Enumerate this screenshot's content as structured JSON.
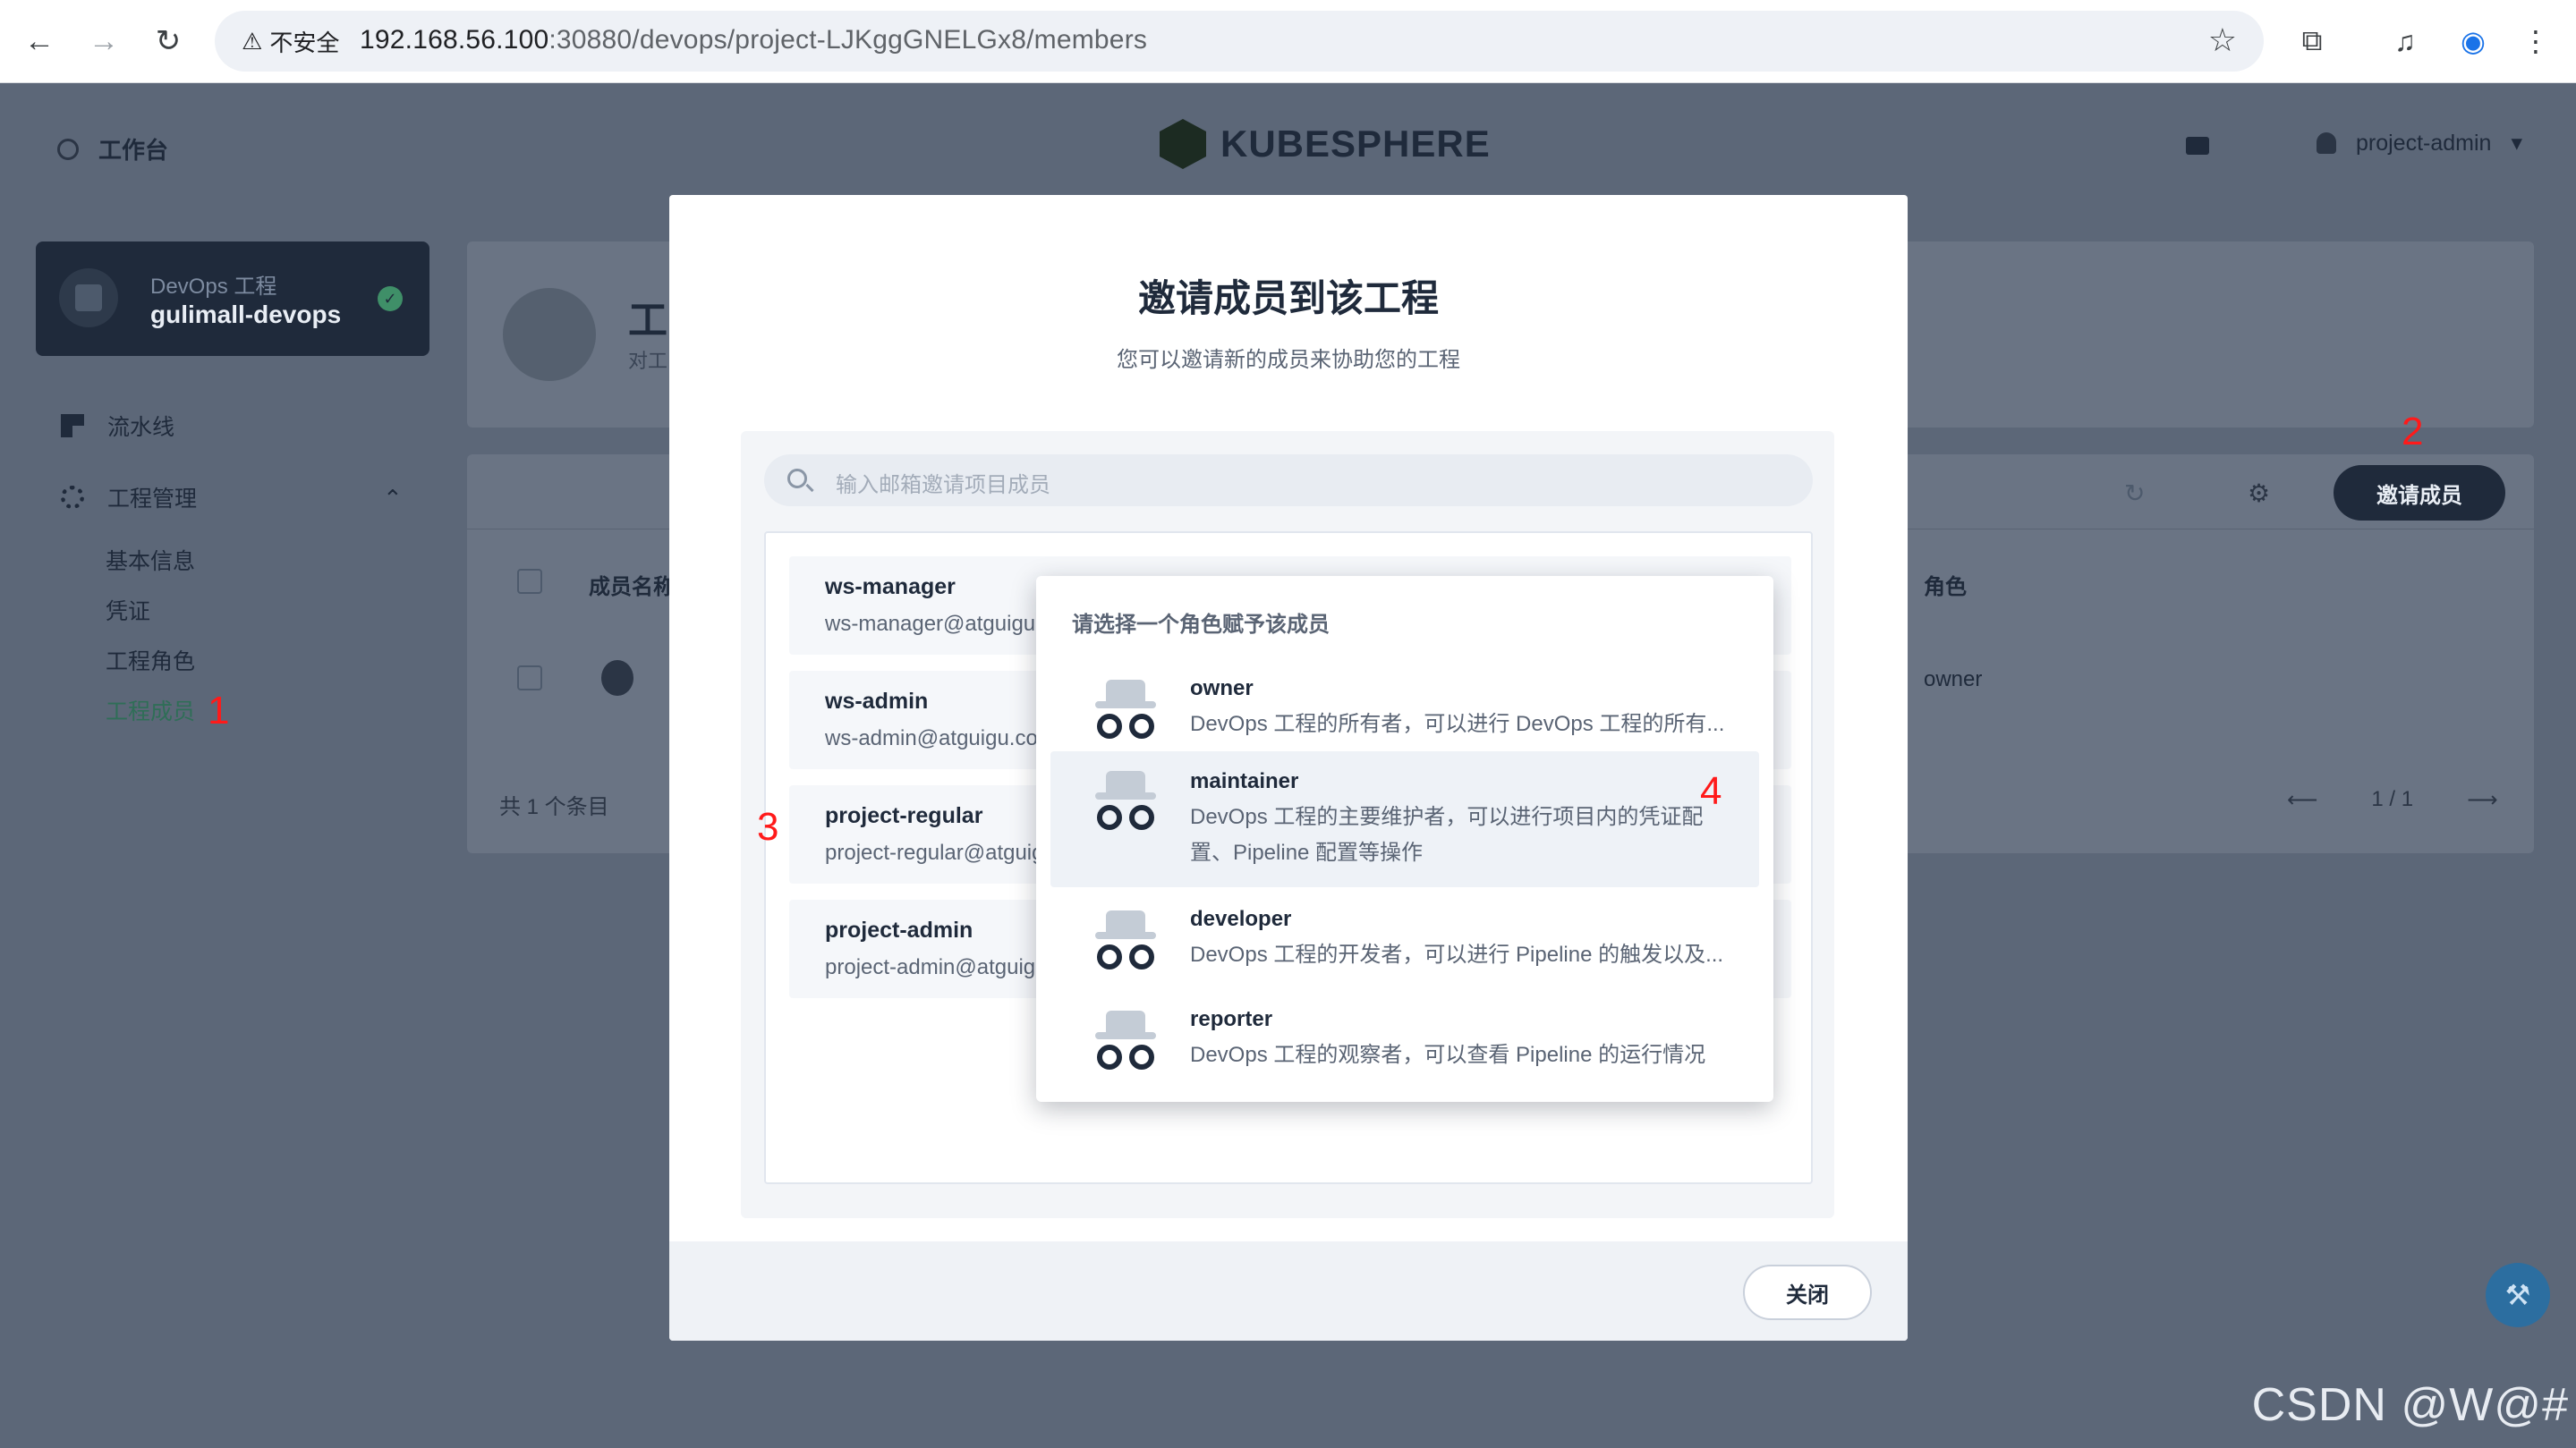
{
  "browser": {
    "security_label": "不安全",
    "url_host": "192.168.56.100",
    "url_rest": ":30880/devops/project-LJKggGNELGx8/members"
  },
  "header": {
    "workbench_label": "工作台",
    "logo_text": "KUBESPHERE",
    "username": "project-admin"
  },
  "sidebar": {
    "project_type": "DevOps 工程",
    "project_name": "gulimall-devops",
    "items": [
      {
        "label": "流水线"
      },
      {
        "label": "工程管理"
      }
    ],
    "sub_items": [
      {
        "label": "基本信息"
      },
      {
        "label": "凭证"
      },
      {
        "label": "工程角色"
      },
      {
        "label": "工程成员",
        "active": true
      }
    ]
  },
  "background": {
    "title_partial": "工",
    "subtitle_partial": "对工",
    "invite_button": "邀请成员",
    "col_name": "成员名称",
    "col_role": "角色",
    "row_role": "owner",
    "footer_count": "共 1 个条目",
    "page_info": "1 / 1"
  },
  "annotations": [
    "1",
    "2",
    "3",
    "4"
  ],
  "modal": {
    "title": "邀请成员到该工程",
    "subtitle": "您可以邀请新的成员来协助您的工程",
    "search_placeholder": "输入邮箱邀请项目成员",
    "users": [
      {
        "name": "ws-manager",
        "email": "ws-manager@atguigu."
      },
      {
        "name": "ws-admin",
        "email": "ws-admin@atguigu.co"
      },
      {
        "name": "project-regular",
        "email": "project-regular@atguig"
      },
      {
        "name": "project-admin",
        "email": "project-admin@atguigu"
      }
    ],
    "close_button": "关闭"
  },
  "role_dropdown": {
    "title": "请选择一个角色赋予该成员",
    "roles": [
      {
        "name": "owner",
        "desc": "DevOps 工程的所有者，可以进行 DevOps 工程的所有..."
      },
      {
        "name": "maintainer",
        "desc": "DevOps 工程的主要维护者，可以进行项目内的凭证配置、Pipeline 配置等操作",
        "selected": true
      },
      {
        "name": "developer",
        "desc": "DevOps 工程的开发者，可以进行 Pipeline 的触发以及..."
      },
      {
        "name": "reporter",
        "desc": "DevOps 工程的观察者，可以查看 Pipeline 的运行情况"
      }
    ]
  },
  "watermark": "CSDN @W@#"
}
